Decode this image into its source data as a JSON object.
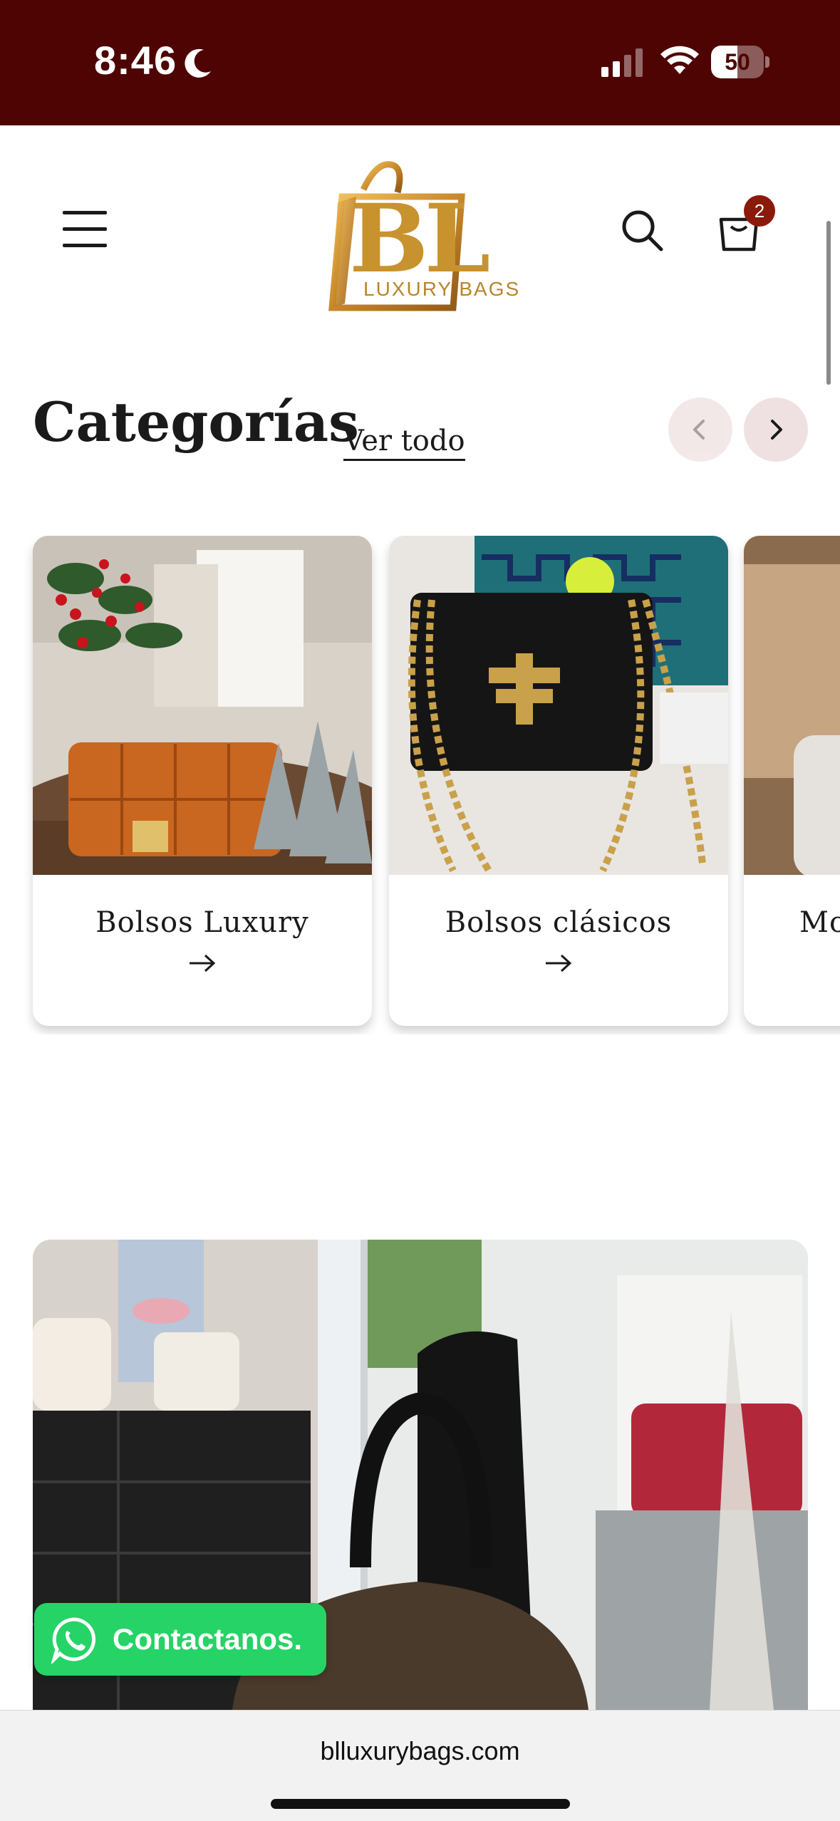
{
  "status_bar": {
    "time": "8:46",
    "battery_level": "50",
    "battery_fraction": 0.5,
    "background_color": "#4f0404"
  },
  "header": {
    "logo": {
      "monogram": "BL",
      "subtitle": "LUXURY BAGS"
    },
    "icons": [
      "menu-icon",
      "search-icon",
      "cart-icon"
    ],
    "cart_count": "2"
  },
  "categories": {
    "title": "Categorías",
    "view_all_label": "Ver todo",
    "items": [
      {
        "label": "Bolsos Luxury",
        "arrow": "→"
      },
      {
        "label": "Bolsos clásicos",
        "arrow": "→"
      },
      {
        "label": "Mo",
        "arrow": ""
      }
    ]
  },
  "whatsapp": {
    "label": "Contactanos.",
    "color": "#25d366"
  },
  "browser": {
    "url": "blluxurybags.com"
  }
}
